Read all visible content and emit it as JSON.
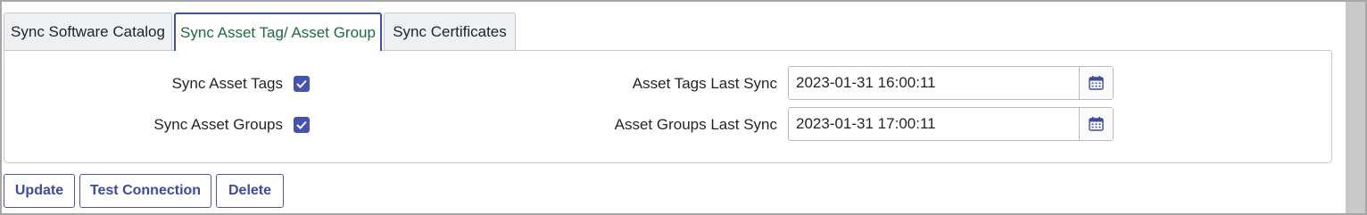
{
  "tabs": [
    {
      "label": "Sync Software Catalog",
      "active": false
    },
    {
      "label": "Sync Asset Tag/ Asset Group",
      "active": true
    },
    {
      "label": "Sync Certificates",
      "active": false
    }
  ],
  "form": {
    "sync_asset_tags": {
      "label": "Sync Asset Tags",
      "checked": true
    },
    "sync_asset_groups": {
      "label": "Sync Asset Groups",
      "checked": true
    },
    "asset_tags_last_sync": {
      "label": "Asset Tags Last Sync",
      "value": "2023-01-31 16:00:11"
    },
    "asset_groups_last_sync": {
      "label": "Asset Groups Last Sync",
      "value": "2023-01-31 17:00:11"
    }
  },
  "buttons": {
    "update": "Update",
    "test_connection": "Test Connection",
    "delete": "Delete"
  },
  "icons": {
    "calendar": "calendar-icon",
    "check": "checkmark-icon"
  },
  "colors": {
    "accent": "#4652b3",
    "active_tab_text": "#1c6b3f",
    "button_text": "#3d4aa0"
  }
}
